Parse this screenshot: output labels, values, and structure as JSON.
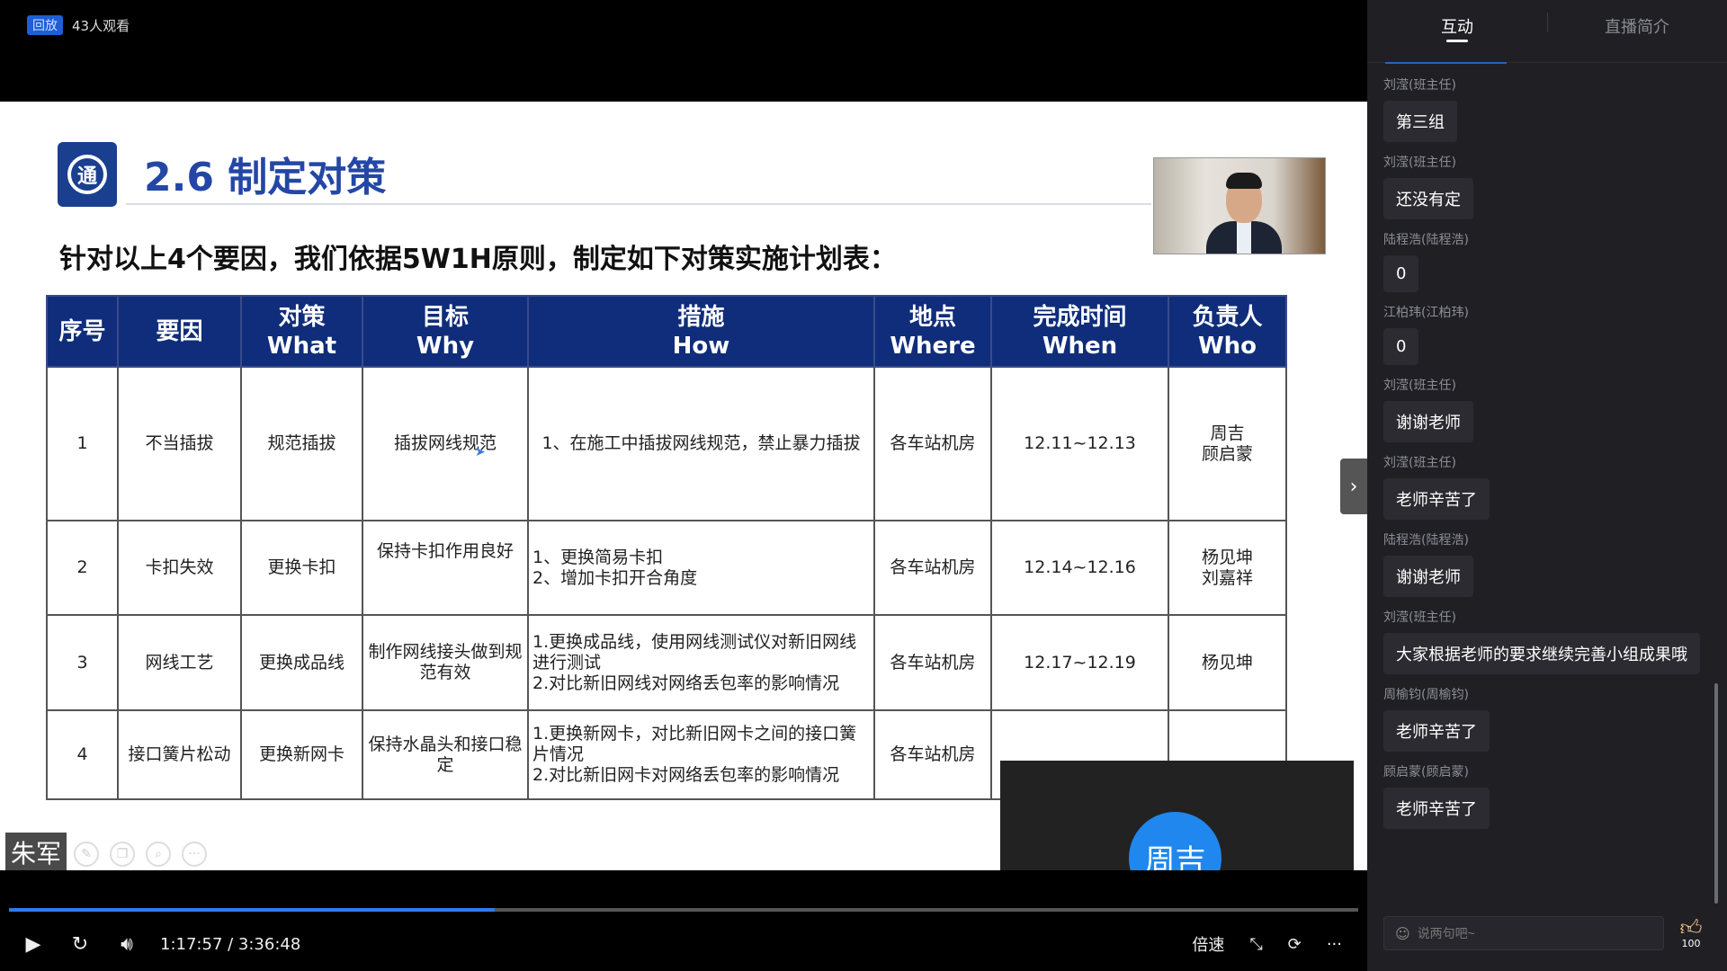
{
  "topbar": {
    "replay_label": "回放",
    "viewers": "43人观看"
  },
  "slide": {
    "title": "2.6 制定对策",
    "subtitle": "针对以上4个要因，我们依据5W1H原则，制定如下对策实施计划表：",
    "logo_text": "通",
    "headers": [
      [
        "序号"
      ],
      [
        "要因"
      ],
      [
        "对策",
        "What"
      ],
      [
        "目标",
        "Why"
      ],
      [
        "措施",
        "How"
      ],
      [
        "地点",
        "Where"
      ],
      [
        "完成时间",
        "When"
      ],
      [
        "负责人",
        "Who"
      ]
    ],
    "rows": [
      {
        "no": "1",
        "cause": "不当插拔",
        "what": "规范插拔",
        "why": [
          "插拔网线规范"
        ],
        "how": [
          "1、在施工中插拔网线规范，禁止暴力插拔"
        ],
        "where": "各车站机房",
        "when": "12.11~12.13",
        "who": [
          "周吉",
          "顾启蒙"
        ]
      },
      {
        "no": "2",
        "cause": "卡扣失效",
        "what": "更换卡扣",
        "why": [
          "保持卡扣作用良好"
        ],
        "how": [
          "1、更换简易卡扣",
          "2、增加卡扣开合角度"
        ],
        "where": "各车站机房",
        "when": "12.14~12.16",
        "who": [
          "杨见坤",
          "刘嘉祥"
        ]
      },
      {
        "no": "3",
        "cause": "网线工艺",
        "what": "更换成品线",
        "why": [
          "制作网线接头做到规",
          "范有效"
        ],
        "how": [
          "1.更换成品线，使用网线测试仪对新旧网线",
          "进行测试",
          "2.对比新旧网线对网络丢包率的影响情况"
        ],
        "where": "各车站机房",
        "when": "12.17~12.19",
        "who": [
          "杨见坤",
          ""
        ]
      },
      {
        "no": "4",
        "cause": "接口簧片松动",
        "what": "更换新网卡",
        "why": [
          "保持水晶头和接口稳",
          "定"
        ],
        "how": [
          "1.更换新网卡，对比新旧网卡之间的接口簧",
          "片情况",
          "2.对比新旧网卡对网络丢包率的影响情况"
        ],
        "where": "各车站机房",
        "when": "",
        "who": [
          "",
          ""
        ]
      }
    ]
  },
  "speaker": {
    "avatar_text": "周吉",
    "name": "周吉"
  },
  "presenter_tag": "朱军",
  "player": {
    "current_time": "1:17:57",
    "total_time": "3:36:48",
    "time_display": "1:17:57 / 3:36:48",
    "progress_fraction": 0.36,
    "speed_label": "倍速",
    "more_label": "···"
  },
  "side": {
    "tabs": [
      "互动",
      "直播简介"
    ],
    "messages": [
      {
        "user": "刘滢(班主任)",
        "text": "第三组"
      },
      {
        "user": "刘滢(班主任)",
        "text": "还没有定"
      },
      {
        "user": "陆程浩(陆程浩)",
        "text": "0"
      },
      {
        "user": "江柏玮(江柏玮)",
        "text": "0"
      },
      {
        "user": "刘滢(班主任)",
        "text": "谢谢老师"
      },
      {
        "user": "刘滢(班主任)",
        "text": "老师辛苦了"
      },
      {
        "user": "陆程浩(陆程浩)",
        "text": "谢谢老师"
      },
      {
        "user": "刘滢(班主任)",
        "text": "大家根据老师的要求继续完善小组成果哦"
      },
      {
        "user": "周榆钧(周榆钧)",
        "text": "老师辛苦了"
      },
      {
        "user": "顾启蒙(顾启蒙)",
        "text": "老师辛苦了"
      }
    ],
    "input_placeholder": "说两句吧~",
    "like_count": "100"
  },
  "icons": [
    "play-icon",
    "replay-icon",
    "volume-icon",
    "fullscreen-exit-icon",
    "rotate-icon",
    "more-icon",
    "smile-icon",
    "thumbs-up-icon",
    "chevron-right-icon"
  ]
}
